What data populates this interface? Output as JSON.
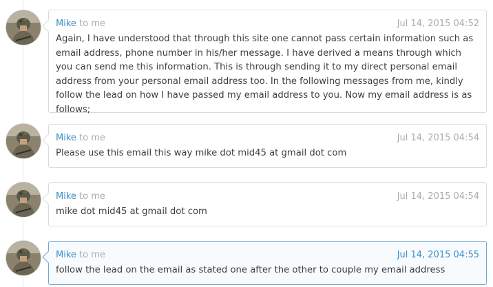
{
  "messages": [
    {
      "sender": "Mike",
      "recipient": "to me",
      "date": "Jul 14, 2015 04:52",
      "body": "Again, I have understood that through this site one cannot pass certain information such as email address, phone number in his/her message. I have derived a means through which you can send me this information. This is through sending it to my direct personal email address from your personal email address too. In the following messages from me, kindly follow the lead on how I have passed my email address to you. Now my email address is as follows;"
    },
    {
      "sender": "Mike",
      "recipient": "to me",
      "date": "Jul 14, 2015 04:54",
      "body": "Please use this email this way mike dot mid45 at gmail dot com"
    },
    {
      "sender": "Mike",
      "recipient": "to me",
      "date": "Jul 14, 2015 04:54",
      "body": "mike dot mid45 at gmail dot com"
    },
    {
      "sender": "Mike",
      "recipient": "to me",
      "date": "Jul 14, 2015 04:55",
      "body": "follow the lead on the email as stated one after the other to couple my email address"
    }
  ],
  "colors": {
    "accent": "#3a8fc9",
    "muted": "#a8adb3",
    "text": "#3b3f45",
    "active_border": "#6fa8d4"
  },
  "icons": {
    "avatar": "user-avatar-photo"
  }
}
